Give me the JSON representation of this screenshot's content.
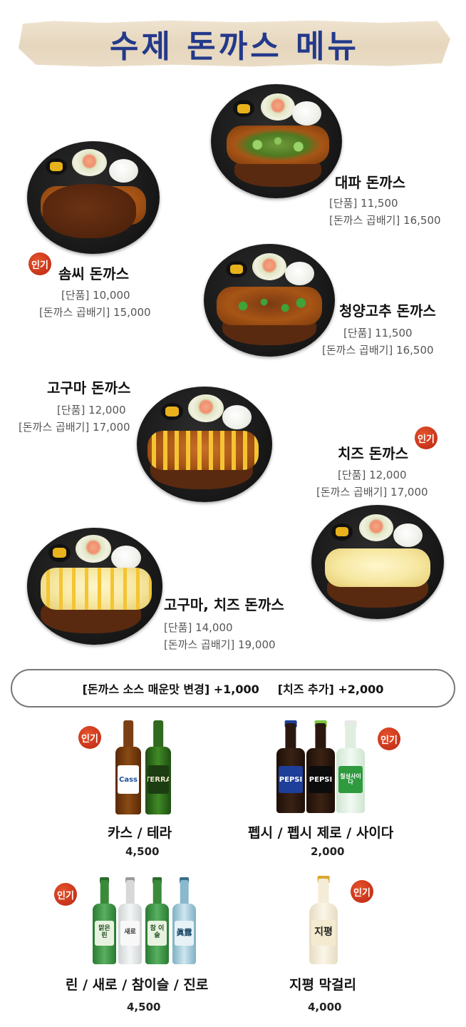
{
  "title": "수제 돈까스 메뉴",
  "popular_badge": "인기",
  "menu_items": [
    {
      "name": "대파 돈까스",
      "price_single": "[단품] 11,500",
      "price_double": "[돈까스 곱배기] 16,500"
    },
    {
      "name": "솜씨 돈까스",
      "price_single": "[단품] 10,000",
      "price_double": "[돈까스 곱배기] 15,000",
      "popular": true
    },
    {
      "name": "청양고추 돈까스",
      "price_single": "[단품] 11,500",
      "price_double": "[돈까스 곱배기] 16,500"
    },
    {
      "name": "고구마 돈까스",
      "price_single": "[단품] 12,000",
      "price_double": "[돈까스 곱배기] 17,000"
    },
    {
      "name": "치즈 돈까스",
      "price_single": "[단품] 12,000",
      "price_double": "[돈까스 곱배기] 17,000",
      "popular": true
    },
    {
      "name": "고구마, 치즈 돈까스",
      "price_single": "[단품] 14,000",
      "price_double": "[돈까스 곱배기] 19,000"
    }
  ],
  "options": {
    "spicy_sauce": "[돈까스 소스 매운맛 변경] +1,000",
    "cheese_add": "[치즈 추가] +2,000"
  },
  "drinks": [
    {
      "name": "카스 / 테라",
      "price": "4,500",
      "popular": true,
      "bottle_labels": [
        "Cass",
        "TERRA"
      ]
    },
    {
      "name": "펩시 / 펩시 제로 / 사이다",
      "price": "2,000",
      "popular": true,
      "bottle_labels": [
        "PEPSI",
        "PEPSI",
        "칠성사이다"
      ]
    },
    {
      "name": "린 / 새로 / 참이슬 / 진로",
      "price": "4,500",
      "popular": true,
      "bottle_labels": [
        "맑은 린",
        "새로",
        "참 이슬",
        "眞露"
      ]
    },
    {
      "name": "지평 막걸리",
      "price": "4,000",
      "popular": true,
      "bottle_labels": [
        "지평"
      ]
    }
  ],
  "colors": {
    "title": "#23398a",
    "badge": "#c8331a",
    "katsu": "#a85516",
    "sauce": "#5a2a10",
    "plate": "#1a1a1a"
  }
}
